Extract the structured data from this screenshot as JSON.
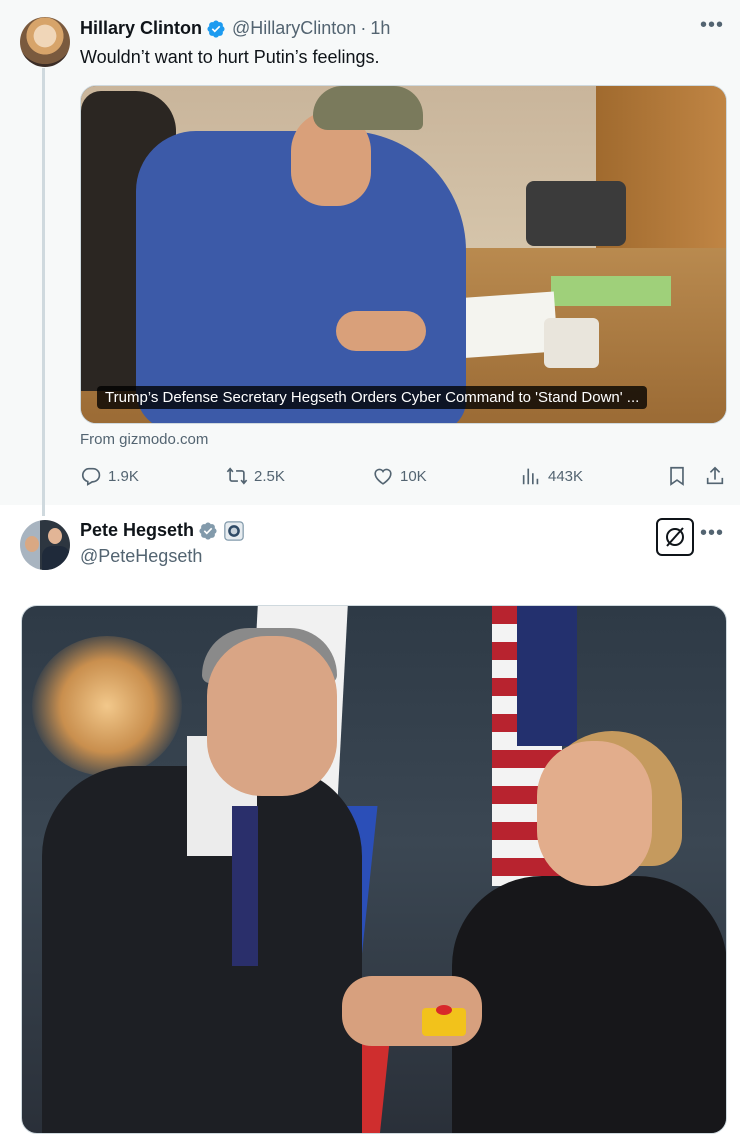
{
  "tweet1": {
    "author_name": "Hillary Clinton",
    "handle": "@HillaryClinton",
    "separator": "·",
    "time": "1h",
    "text": "Wouldn’t want to hurt Putin’s feelings.",
    "card": {
      "headline": "Trump’s Defense Secretary Hegseth Orders Cyber Command to 'Stand Down' ...",
      "source": "From gizmodo.com"
    },
    "actions": {
      "replies": "1.9K",
      "reposts": "2.5K",
      "likes": "10K",
      "views": "443K"
    }
  },
  "tweet2": {
    "author_name": "Pete Hegseth",
    "handle": "@PeteHegseth"
  },
  "colors": {
    "verified_blue": "#1d9bf0",
    "verified_grey": "#829aab",
    "secondary_text": "#536471",
    "context_bg": "#f7f9f9"
  },
  "icons": [
    "verified-badge-icon",
    "government-badge-icon",
    "more-icon",
    "reply-icon",
    "repost-icon",
    "like-icon",
    "views-icon",
    "bookmark-icon",
    "share-icon",
    "grok-icon"
  ]
}
